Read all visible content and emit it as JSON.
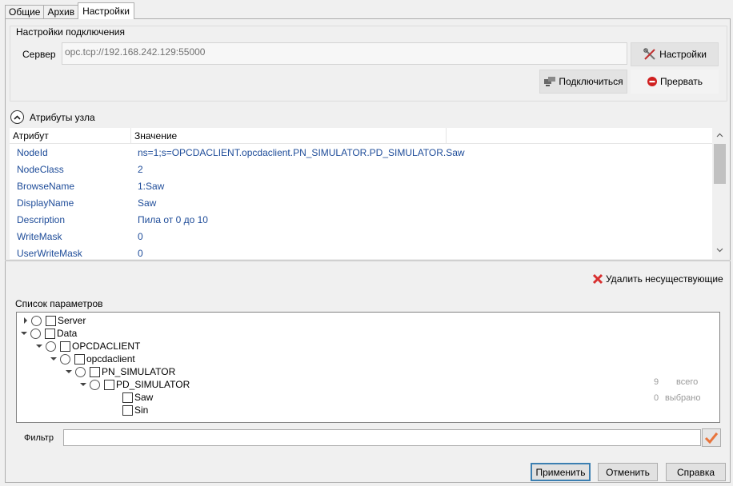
{
  "tabs": [
    {
      "label": "Общие"
    },
    {
      "label": "Архив"
    },
    {
      "label": "Настройки"
    }
  ],
  "connection": {
    "title": "Настройки подключения",
    "server_label": "Сервер",
    "server_value": "opc.tcp://192.168.242.129:55000",
    "settings_button": "Настройки",
    "connect_button": "Подключиться",
    "disconnect_button": "Прервать"
  },
  "attributes": {
    "title": "Атрибуты узла",
    "columns": [
      "Атрибут",
      "Значение"
    ],
    "rows": [
      {
        "name": "NodeId",
        "value": "ns=1;s=OPCDACLIENT.opcdaclient.PN_SIMULATOR.PD_SIMULATOR.Saw"
      },
      {
        "name": "NodeClass",
        "value": "2"
      },
      {
        "name": "BrowseName",
        "value": "1:Saw"
      },
      {
        "name": "DisplayName",
        "value": "Saw"
      },
      {
        "name": "Description",
        "value": "Пила от 0 до 10"
      },
      {
        "name": "WriteMask",
        "value": "0"
      },
      {
        "name": "UserWriteMask",
        "value": "0"
      }
    ]
  },
  "parameters": {
    "delete_button": "Удалить несуществующие",
    "title": "Список параметров",
    "tree": [
      {
        "label": "Server"
      },
      {
        "label": "Data"
      },
      {
        "label": "OPCDACLIENT"
      },
      {
        "label": "opcdaclient"
      },
      {
        "label": "PN_SIMULATOR"
      },
      {
        "label": "PD_SIMULATOR"
      },
      {
        "label": "Saw"
      },
      {
        "label": "Sin"
      }
    ],
    "total_count": "9",
    "total_label": "всего",
    "selected_count": "0",
    "selected_label": "выбрано",
    "filter_label": "Фильтр",
    "filter_value": ""
  },
  "footer": {
    "apply": "Применить",
    "cancel": "Отменить",
    "help": "Справка"
  },
  "colors": {
    "link_text": "#1e4c99",
    "default_button_border": "#3c7fb1",
    "delete_icon": "#d83030",
    "stop_icon": "#d02020",
    "filter_check": "#e8743b"
  },
  "icons": {
    "settings": "tools-icon",
    "connect": "network-icon",
    "disconnect": "stop-icon",
    "delete": "red-x-icon",
    "collapse": "chevron-up-circle-icon",
    "filter": "checkmark-icon"
  }
}
